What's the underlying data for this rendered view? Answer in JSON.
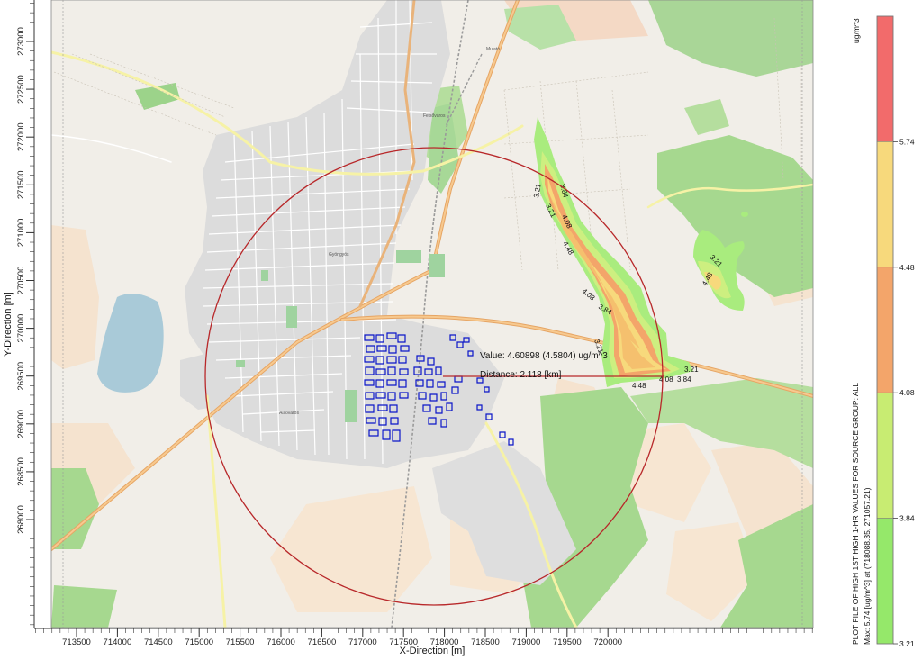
{
  "axes": {
    "x_label": "X-Direction [m]",
    "y_label": "Y-Direction [m]",
    "x_ticks": [
      "713500",
      "714000",
      "714500",
      "715000",
      "715500",
      "716000",
      "716500",
      "717000",
      "717500",
      "718000",
      "718500",
      "719000",
      "719500",
      "720000"
    ],
    "y_ticks": [
      "273000",
      "272500",
      "272000",
      "271500",
      "271000",
      "270500",
      "270000",
      "269500",
      "269000",
      "268500",
      "268000"
    ]
  },
  "annotation": {
    "value_text": "Value: 4.60898 (4.5804) ug/m^3",
    "distance_text": "Distance: 2.118 [km]"
  },
  "contour_labels": {
    "c321": "3.21",
    "c384": "3.84",
    "c408": "4.08",
    "c448": "4.48"
  },
  "town_labels": {
    "gyongyos": "Gyöngyös",
    "felsovaros": "Felsőváros",
    "alsovaros": "Alsóváros",
    "mulato": "Mulató"
  },
  "legend": {
    "unit": "ug/m^3",
    "levels": [
      "5.74",
      "4.48",
      "4.08",
      "3.84",
      "3.21"
    ],
    "colors": [
      "#f26b6b",
      "#f7d97c",
      "#f3a56a",
      "#c8ec72",
      "#95e86a"
    ],
    "title": "PLOT FILE OF HIGH 1ST HIGH 1-HR VALUES FOR SOURCE GROUP: ALL",
    "max_text": "Max:  5.74  [ug/m^3]  at  (718088.35, 271057.21)"
  },
  "chart_data": {
    "type": "contour-map",
    "x_axis": {
      "label": "X-Direction [m]",
      "range": [
        713250,
        720300
      ]
    },
    "y_axis": {
      "label": "Y-Direction [m]",
      "range": [
        267700,
        273300
      ]
    },
    "contour_levels": [
      3.21,
      3.84,
      4.08,
      4.48,
      5.74
    ],
    "units": "ug/m^3",
    "max": {
      "value": 5.74,
      "x": 718088.35,
      "y": 271057.21
    },
    "probe": {
      "value": 4.60898,
      "value_alt": 4.5804,
      "distance_km": 2.118
    },
    "source_group": "ALL"
  }
}
